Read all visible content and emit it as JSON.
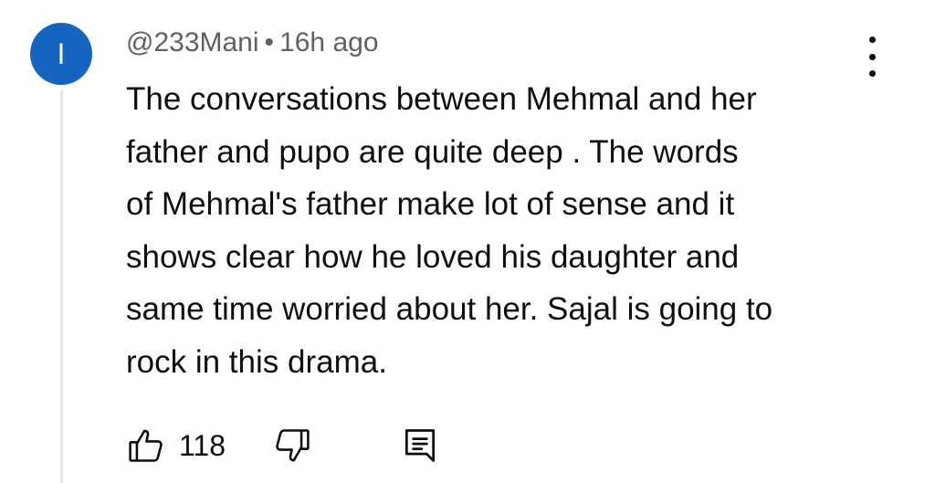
{
  "comment": {
    "avatar_initial": "I",
    "avatar_color": "#1565c0",
    "author": "@233Mani",
    "separator": "•",
    "time_ago": "16h ago",
    "text_lines": [
      "The conversations between Mehmal and her",
      "father and pupo are quite deep .  The words",
      "of Mehmal's father make lot of sense and it",
      "shows clear how he loved his daughter and",
      "same time worried about her. Sajal is going to",
      "rock in this drama."
    ],
    "like_count": "118"
  },
  "icons": {
    "like": "thumbs-up-icon",
    "dislike": "thumbs-down-icon",
    "reply": "reply-comment-icon",
    "menu": "more-vertical-icon"
  }
}
